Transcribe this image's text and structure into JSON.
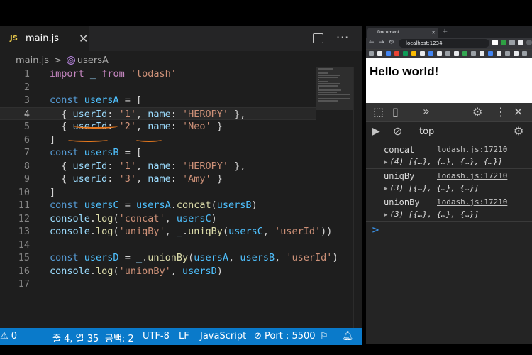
{
  "editor": {
    "tab": {
      "badge": "JS",
      "title": "main.js",
      "close": "✕"
    },
    "more": "···",
    "breadcrumb": {
      "file": "main.js",
      "separator": ">",
      "symbol": "usersA"
    },
    "code": [
      {
        "num": "1",
        "text": "import _ from 'lodash'"
      },
      {
        "num": "2",
        "text": ""
      },
      {
        "num": "3",
        "text": "const usersA = ["
      },
      {
        "num": "4",
        "text": "  { userId: '1', name: 'HEROPY' },"
      },
      {
        "num": "5",
        "text": "  { userId: '2', name: 'Neo' }"
      },
      {
        "num": "6",
        "text": "]"
      },
      {
        "num": "7",
        "text": "const usersB = ["
      },
      {
        "num": "8",
        "text": "  { userId: '1', name: 'HEROPY' },"
      },
      {
        "num": "9",
        "text": "  { userId: '3', name: 'Amy' }"
      },
      {
        "num": "10",
        "text": "]"
      },
      {
        "num": "11",
        "text": "const usersC = usersA.concat(usersB)"
      },
      {
        "num": "12",
        "text": "console.log('concat', usersC)"
      },
      {
        "num": "13",
        "text": "console.log('uniqBy', _.uniqBy(usersC, 'userId'))"
      },
      {
        "num": "14",
        "text": ""
      },
      {
        "num": "15",
        "text": "const usersD = _.unionBy(usersA, usersB, 'userId')"
      },
      {
        "num": "16",
        "text": "console.log('unionBy', usersD)"
      },
      {
        "num": "17",
        "text": ""
      }
    ],
    "current_line": 4
  },
  "statusbar": {
    "problems": "0",
    "position": "줄 4, 열 35",
    "spaces": "공백: 2",
    "encoding": "UTF-8",
    "eol": "LF",
    "language": "JavaScript",
    "port": "Port : 5500"
  },
  "browser": {
    "tab_title": "Document",
    "url": "localhost:1234",
    "heading": "Hello world!",
    "console_context": "top",
    "logs": [
      {
        "label": "concat",
        "source": "lodash.js:17210",
        "value": "(4) [{…}, {…}, {…}, {…}]"
      },
      {
        "label": "uniqBy",
        "source": "lodash.js:17210",
        "value": "(3) [{…}, {…}, {…}]"
      },
      {
        "label": "unionBy",
        "source": "lodash.js:17210",
        "value": "(3) [{…}, {…}, {…}]"
      }
    ],
    "prompt": ">"
  },
  "colors": {
    "statusbar": "#0a7aca",
    "annotation": "#e7791e",
    "keyword": "#569cd6",
    "string": "#ce9178"
  }
}
